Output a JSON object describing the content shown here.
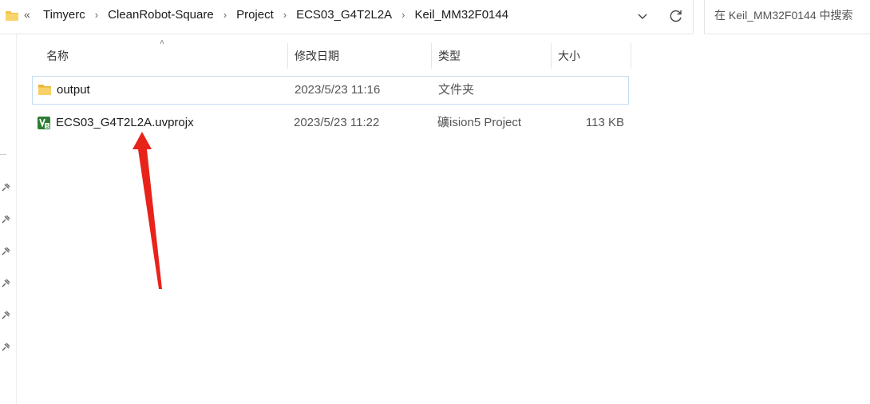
{
  "address_bar": {
    "overflow_label": "«",
    "breadcrumbs": [
      "Timyerc",
      "CleanRobot-Square",
      "Project",
      "ECS03_G4T2L2A",
      "Keil_MM32F0144"
    ]
  },
  "search": {
    "placeholder": "在 Keil_MM32F0144 中搜索"
  },
  "columns": {
    "name": "名称",
    "modified": "修改日期",
    "type": "类型",
    "size": "大小"
  },
  "files": [
    {
      "name": "output",
      "modified": "2023/5/23 11:16",
      "type": "文件夹",
      "size": "",
      "icon": "folder-icon"
    },
    {
      "name": "ECS03_G4T2L2A.uvprojx",
      "modified": "2023/5/23 11:22",
      "type": "礦ision5 Project",
      "size": "113 KB",
      "icon": "uvision-project-icon"
    }
  ],
  "colors": {
    "annotation_arrow": "#e8231a",
    "folder": "#f3c44a",
    "selection_border": "#c4dcf2"
  }
}
